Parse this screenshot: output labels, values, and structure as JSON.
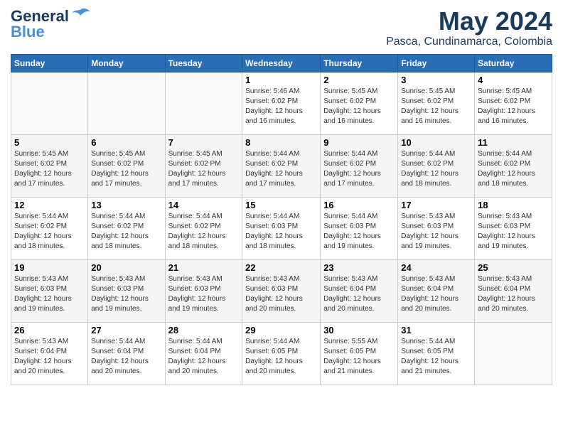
{
  "header": {
    "logo_general": "General",
    "logo_blue": "Blue",
    "month": "May 2024",
    "location": "Pasca, Cundinamarca, Colombia"
  },
  "days_of_week": [
    "Sunday",
    "Monday",
    "Tuesday",
    "Wednesday",
    "Thursday",
    "Friday",
    "Saturday"
  ],
  "weeks": [
    {
      "days": [
        {
          "num": "",
          "info": ""
        },
        {
          "num": "",
          "info": ""
        },
        {
          "num": "",
          "info": ""
        },
        {
          "num": "1",
          "info": "Sunrise: 5:46 AM\nSunset: 6:02 PM\nDaylight: 12 hours\nand 16 minutes."
        },
        {
          "num": "2",
          "info": "Sunrise: 5:45 AM\nSunset: 6:02 PM\nDaylight: 12 hours\nand 16 minutes."
        },
        {
          "num": "3",
          "info": "Sunrise: 5:45 AM\nSunset: 6:02 PM\nDaylight: 12 hours\nand 16 minutes."
        },
        {
          "num": "4",
          "info": "Sunrise: 5:45 AM\nSunset: 6:02 PM\nDaylight: 12 hours\nand 16 minutes."
        }
      ]
    },
    {
      "days": [
        {
          "num": "5",
          "info": "Sunrise: 5:45 AM\nSunset: 6:02 PM\nDaylight: 12 hours\nand 17 minutes."
        },
        {
          "num": "6",
          "info": "Sunrise: 5:45 AM\nSunset: 6:02 PM\nDaylight: 12 hours\nand 17 minutes."
        },
        {
          "num": "7",
          "info": "Sunrise: 5:45 AM\nSunset: 6:02 PM\nDaylight: 12 hours\nand 17 minutes."
        },
        {
          "num": "8",
          "info": "Sunrise: 5:44 AM\nSunset: 6:02 PM\nDaylight: 12 hours\nand 17 minutes."
        },
        {
          "num": "9",
          "info": "Sunrise: 5:44 AM\nSunset: 6:02 PM\nDaylight: 12 hours\nand 17 minutes."
        },
        {
          "num": "10",
          "info": "Sunrise: 5:44 AM\nSunset: 6:02 PM\nDaylight: 12 hours\nand 18 minutes."
        },
        {
          "num": "11",
          "info": "Sunrise: 5:44 AM\nSunset: 6:02 PM\nDaylight: 12 hours\nand 18 minutes."
        }
      ]
    },
    {
      "days": [
        {
          "num": "12",
          "info": "Sunrise: 5:44 AM\nSunset: 6:02 PM\nDaylight: 12 hours\nand 18 minutes."
        },
        {
          "num": "13",
          "info": "Sunrise: 5:44 AM\nSunset: 6:02 PM\nDaylight: 12 hours\nand 18 minutes."
        },
        {
          "num": "14",
          "info": "Sunrise: 5:44 AM\nSunset: 6:02 PM\nDaylight: 12 hours\nand 18 minutes."
        },
        {
          "num": "15",
          "info": "Sunrise: 5:44 AM\nSunset: 6:03 PM\nDaylight: 12 hours\nand 18 minutes."
        },
        {
          "num": "16",
          "info": "Sunrise: 5:44 AM\nSunset: 6:03 PM\nDaylight: 12 hours\nand 19 minutes."
        },
        {
          "num": "17",
          "info": "Sunrise: 5:43 AM\nSunset: 6:03 PM\nDaylight: 12 hours\nand 19 minutes."
        },
        {
          "num": "18",
          "info": "Sunrise: 5:43 AM\nSunset: 6:03 PM\nDaylight: 12 hours\nand 19 minutes."
        }
      ]
    },
    {
      "days": [
        {
          "num": "19",
          "info": "Sunrise: 5:43 AM\nSunset: 6:03 PM\nDaylight: 12 hours\nand 19 minutes."
        },
        {
          "num": "20",
          "info": "Sunrise: 5:43 AM\nSunset: 6:03 PM\nDaylight: 12 hours\nand 19 minutes."
        },
        {
          "num": "21",
          "info": "Sunrise: 5:43 AM\nSunset: 6:03 PM\nDaylight: 12 hours\nand 19 minutes."
        },
        {
          "num": "22",
          "info": "Sunrise: 5:43 AM\nSunset: 6:03 PM\nDaylight: 12 hours\nand 20 minutes."
        },
        {
          "num": "23",
          "info": "Sunrise: 5:43 AM\nSunset: 6:04 PM\nDaylight: 12 hours\nand 20 minutes."
        },
        {
          "num": "24",
          "info": "Sunrise: 5:43 AM\nSunset: 6:04 PM\nDaylight: 12 hours\nand 20 minutes."
        },
        {
          "num": "25",
          "info": "Sunrise: 5:43 AM\nSunset: 6:04 PM\nDaylight: 12 hours\nand 20 minutes."
        }
      ]
    },
    {
      "days": [
        {
          "num": "26",
          "info": "Sunrise: 5:43 AM\nSunset: 6:04 PM\nDaylight: 12 hours\nand 20 minutes."
        },
        {
          "num": "27",
          "info": "Sunrise: 5:44 AM\nSunset: 6:04 PM\nDaylight: 12 hours\nand 20 minutes."
        },
        {
          "num": "28",
          "info": "Sunrise: 5:44 AM\nSunset: 6:04 PM\nDaylight: 12 hours\nand 20 minutes."
        },
        {
          "num": "29",
          "info": "Sunrise: 5:44 AM\nSunset: 6:05 PM\nDaylight: 12 hours\nand 20 minutes."
        },
        {
          "num": "30",
          "info": "Sunrise: 5:55 AM\nSunset: 6:05 PM\nDaylight: 12 hours\nand 21 minutes."
        },
        {
          "num": "31",
          "info": "Sunrise: 5:44 AM\nSunset: 6:05 PM\nDaylight: 12 hours\nand 21 minutes."
        },
        {
          "num": "",
          "info": ""
        }
      ]
    }
  ]
}
